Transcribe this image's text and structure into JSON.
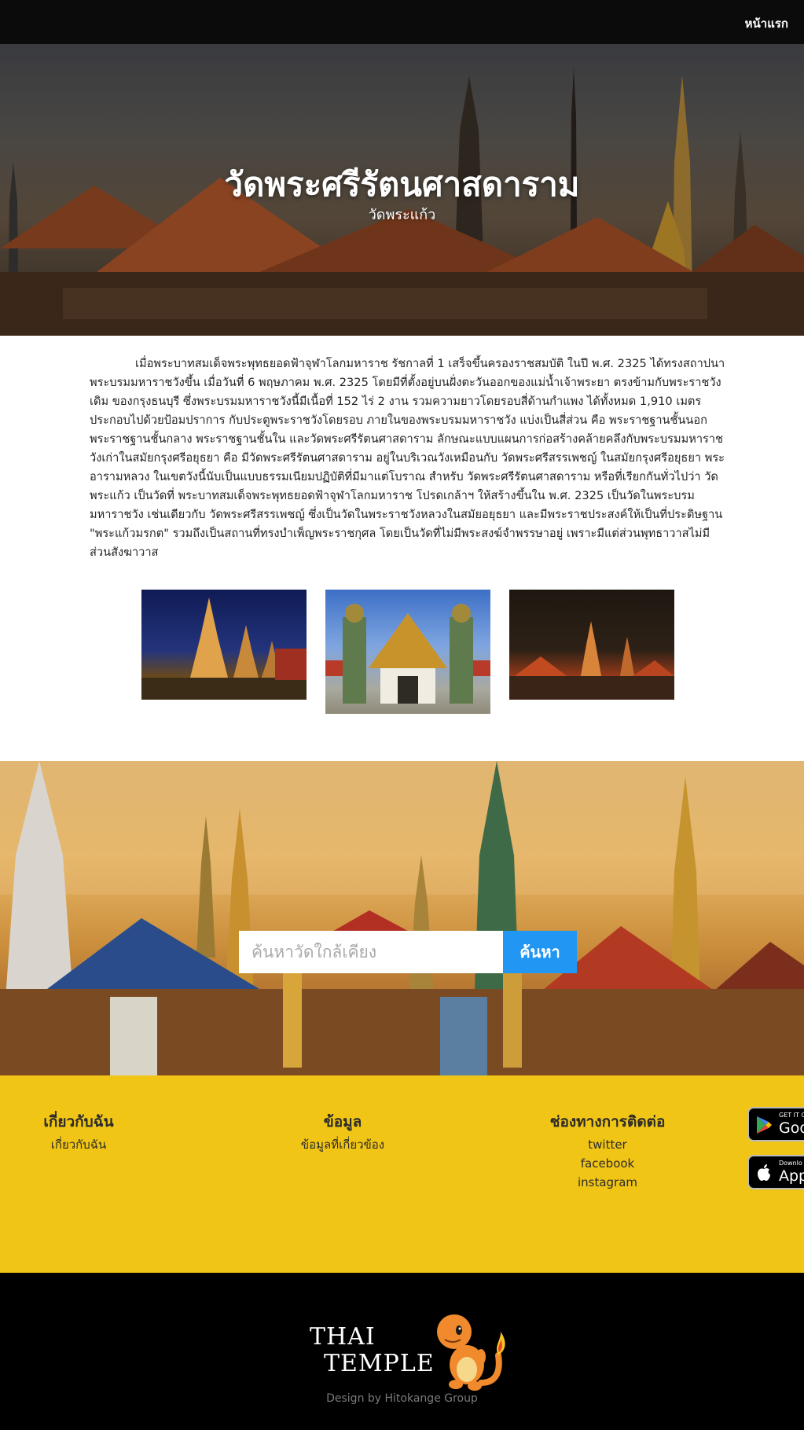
{
  "nav": {
    "home_label": "หน้าแรก"
  },
  "hero": {
    "title": "วัดพระศรีรัตนศาสดาราม",
    "subtitle": "วัดพระแก้ว"
  },
  "content": {
    "paragraph": "เมื่อพระบาทสมเด็จพระพุทธยอดฟ้าจุฬาโลกมหาราช รัชกาลที่ 1 เสร็จขึ้นครองราชสมบัติ ในปี พ.ศ. 2325 ได้ทรงสถาปนาพระบรมมหาราชวังขึ้น เมื่อวันที่ 6 พฤษภาคม พ.ศ. 2325 โดยมีที่ตั้งอยู่บนฝั่งตะวันออกของแม่น้ำเจ้าพระยา ตรงข้ามกับพระราชวังเดิม ของกรุงธนบุรี ซึ่งพระบรมมหาราชวังนี้มีเนื้อที่ 152 ไร่ 2 งาน รวมความยาวโดยรอบสี่ด้านกำแพง ได้ทั้งหมด 1,910 เมตร ประกอบไปด้วยป้อมปราการ กับประตูพระราชวังโดยรอบ ภายในของพระบรมมหาราชวัง แบ่งเป็นสี่ส่วน คือ พระราชฐานชั้นนอก พระราชฐานชั้นกลาง พระราชฐานชั้นใน และวัดพระศรีรัตนศาสดาราม ลักษณะแบบแผนการก่อสร้างคล้ายคลึงกับพระบรมมหาราชวังเก่าในสมัยกรุงศรีอยุธยา คือ มีวัดพระศรีรัตนศาสดาราม อยู่ในบริเวณวังเหมือนกับ วัดพระศรีสรรเพชญ์ ในสมัยกรุงศรีอยุธยา พระอารามหลวง ในเขตวังนี้นับเป็นแบบธรรมเนียมปฏิบัติที่มีมาแต่โบราณ สำหรับ วัดพระศรีรัตนศาสดาราม หรือที่เรียกกันทั่วไปว่า วัดพระแก้ว เป็นวัดที่ พระบาทสมเด็จพระพุทธยอดฟ้าจุฬาโลกมหาราช โปรดเกล้าฯ ให้สร้างขึ้นใน พ.ศ. 2325 เป็นวัดในพระบรมมหาราชวัง เช่นเดียวกับ วัดพระศรีสรรเพชญ์ ซึ่งเป็นวัดในพระราชวังหลวงในสมัยอยุธยา และมีพระราชประสงค์ให้เป็นที่ประดิษฐาน \"พระแก้วมรกต\" รวมถึงเป็นสถานที่ทรงบำเพ็ญพระราชกุศล โดยเป็นวัดที่ไม่มีพระสงฆ์จำพรรษาอยู่ เพราะมีแต่ส่วนพุทธาวาสไม่มีส่วนสังฆาวาส"
  },
  "search": {
    "placeholder": "ค้นหาวัดใกล้เคียง",
    "button_label": "ค้นหา",
    "button_color": "#2196f3"
  },
  "footer": {
    "background": "#f1c515",
    "about": {
      "heading": "เกี่ยวกับฉัน",
      "links": [
        "เกี่ยวกับฉัน"
      ]
    },
    "info": {
      "heading": "ข้อมูล",
      "links": [
        "ข้อมูลที่เกี่ยวข้อง"
      ]
    },
    "contact": {
      "heading": "ช่องทางการติดต่อ",
      "links": [
        "twitter",
        "facebook",
        "instagram"
      ]
    },
    "stores": {
      "google_small": "GET IT O",
      "google_big": "Goo",
      "apple_small": "Downlo",
      "apple_big": "App"
    }
  },
  "bottom": {
    "logo_line1": "THAI",
    "logo_line2": "TEMPLE",
    "credit": "Design by Hitokange Group"
  }
}
